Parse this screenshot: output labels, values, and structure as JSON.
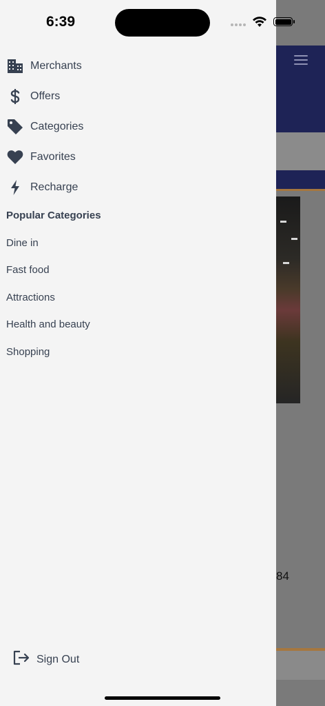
{
  "status_bar": {
    "time": "6:39"
  },
  "menu": {
    "items": [
      {
        "label": "Merchants",
        "icon": "building-icon"
      },
      {
        "label": "Offers",
        "icon": "dollar-icon"
      },
      {
        "label": "Categories",
        "icon": "tag-icon"
      },
      {
        "label": "Favorites",
        "icon": "heart-icon"
      },
      {
        "label": "Recharge",
        "icon": "bolt-icon"
      }
    ]
  },
  "popular": {
    "title": "Popular Categories",
    "items": [
      "Dine in",
      "Fast food",
      "Attractions",
      "Health and beauty",
      "Shopping"
    ]
  },
  "signout": {
    "label": "Sign Out",
    "icon": "sign-out-icon"
  },
  "background": {
    "partial_number": "84"
  },
  "colors": {
    "text": "#374151",
    "drawer_bg": "#f4f4f4",
    "header_navy": "#1e2356",
    "accent_gold": "#a6773f"
  }
}
